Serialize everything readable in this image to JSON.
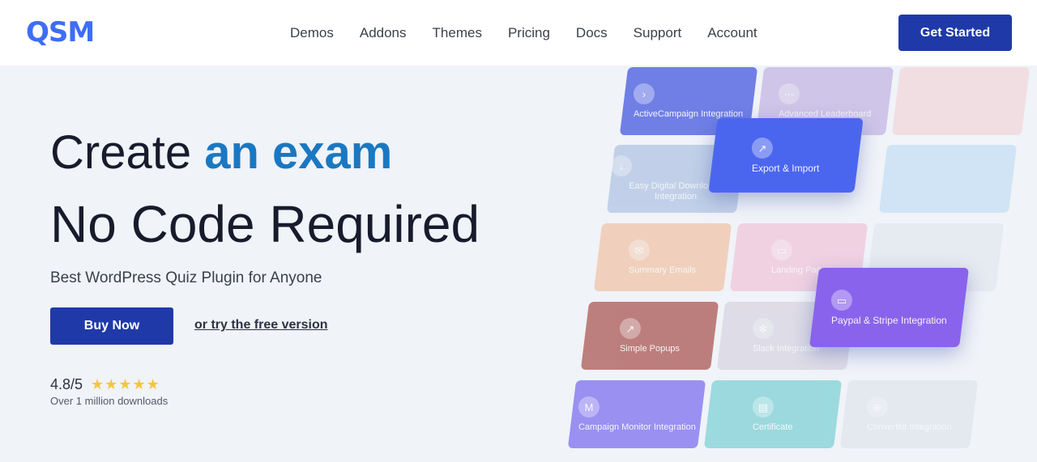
{
  "header": {
    "logo": "QSM",
    "nav": [
      "Demos",
      "Addons",
      "Themes",
      "Pricing",
      "Docs",
      "Support",
      "Account"
    ],
    "cta": "Get Started"
  },
  "hero": {
    "headline_part1": "Create ",
    "headline_accent": "an exam",
    "headline_line2": "No Code Required",
    "subtitle": "Best WordPress Quiz Plugin for Anyone",
    "buy_label": "Buy Now",
    "free_link": "or try the free version",
    "rating": "4.8/5",
    "stars": "★★★★★",
    "downloads": "Over 1 million downloads"
  },
  "tiles": [
    {
      "label": "ActiveCampaign Integration",
      "icon": "›",
      "color": "#6f7fe6"
    },
    {
      "label": "Advanced Leaderboard",
      "icon": "⋯",
      "color": "#a98fd6"
    },
    {
      "label": "",
      "icon": "",
      "color": "#f1c5c9"
    },
    {
      "label": "Easy Digital Downloads Integration",
      "icon": "↓",
      "color": "#8aa6d6"
    },
    {
      "label": "Export & Import",
      "icon": "↗",
      "color": "#4b66ee"
    },
    {
      "label": "",
      "icon": "",
      "color": "#a9d2f2"
    },
    {
      "label": "Summary Emails",
      "icon": "✉",
      "color": "#f0a774"
    },
    {
      "label": "Landing Page",
      "icon": "▭",
      "color": "#f0a9c9"
    },
    {
      "label": "",
      "icon": "",
      "color": "#d9dfe9"
    },
    {
      "label": "Simple Popups",
      "icon": "↗",
      "color": "#b0625e"
    },
    {
      "label": "Slack Integration",
      "icon": "✻",
      "color": "#c9c2d1"
    },
    {
      "label": "Paypal & Stripe Integration",
      "icon": "▭",
      "color": "#8a63ec"
    },
    {
      "label": "Campaign Monitor Integration",
      "icon": "M",
      "color": "#8c7ff0"
    },
    {
      "label": "Certificate",
      "icon": "▤",
      "color": "#7fd1d6"
    },
    {
      "label": "Convertkit Integration",
      "icon": "⊕",
      "color": "#d6dbe6"
    }
  ]
}
